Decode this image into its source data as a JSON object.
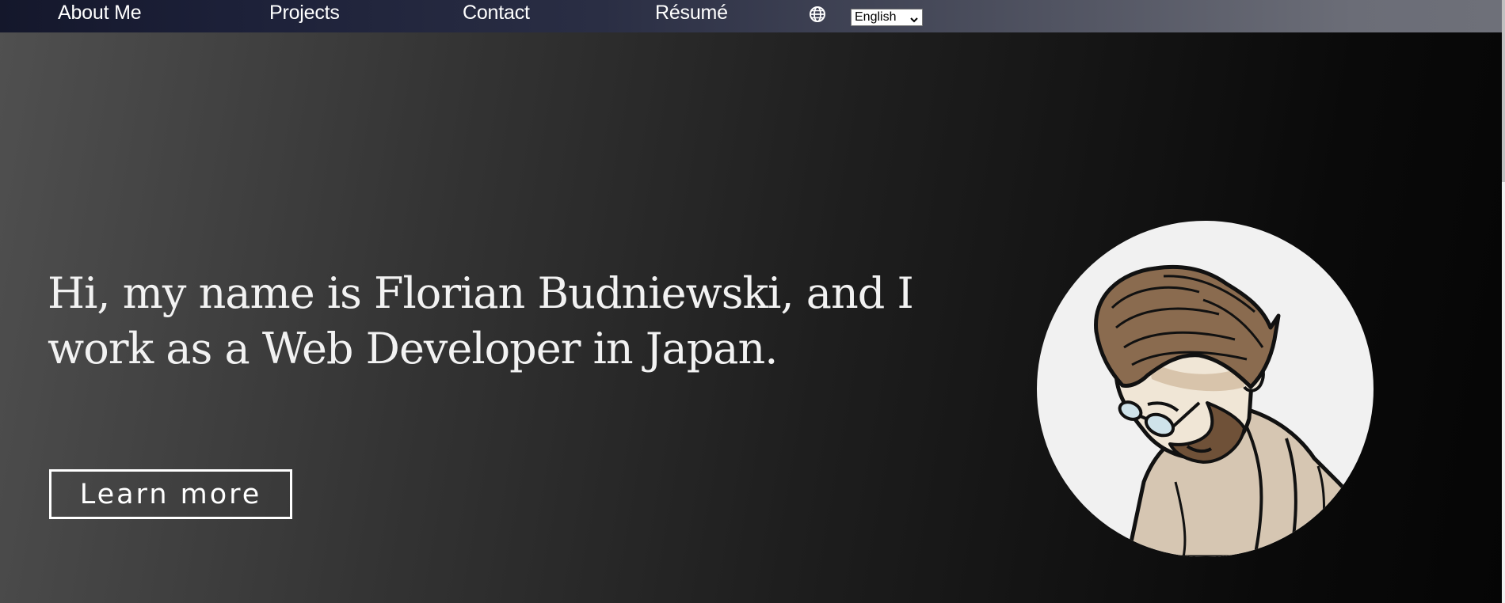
{
  "nav": {
    "items": [
      {
        "label": "About Me"
      },
      {
        "label": "Projects"
      },
      {
        "label": "Contact"
      },
      {
        "label": "Résumé"
      }
    ],
    "globe_icon": "globe-icon",
    "language_select": {
      "selected": "English"
    }
  },
  "hero": {
    "heading": "Hi, my name is Florian Budniewski, and I work as a Web Developer in Japan.",
    "cta_label": "Learn more",
    "avatar": "illustrated-portrait-man-glasses-beard"
  },
  "colors": {
    "text": "#ffffff",
    "background_dark": "#0a0a0a",
    "background_light": "#505050",
    "navbar": "#1c2038",
    "avatar_bg": "#f1f1f1",
    "hair": "#8a6b4f",
    "hoodie": "#d6c6b2"
  }
}
